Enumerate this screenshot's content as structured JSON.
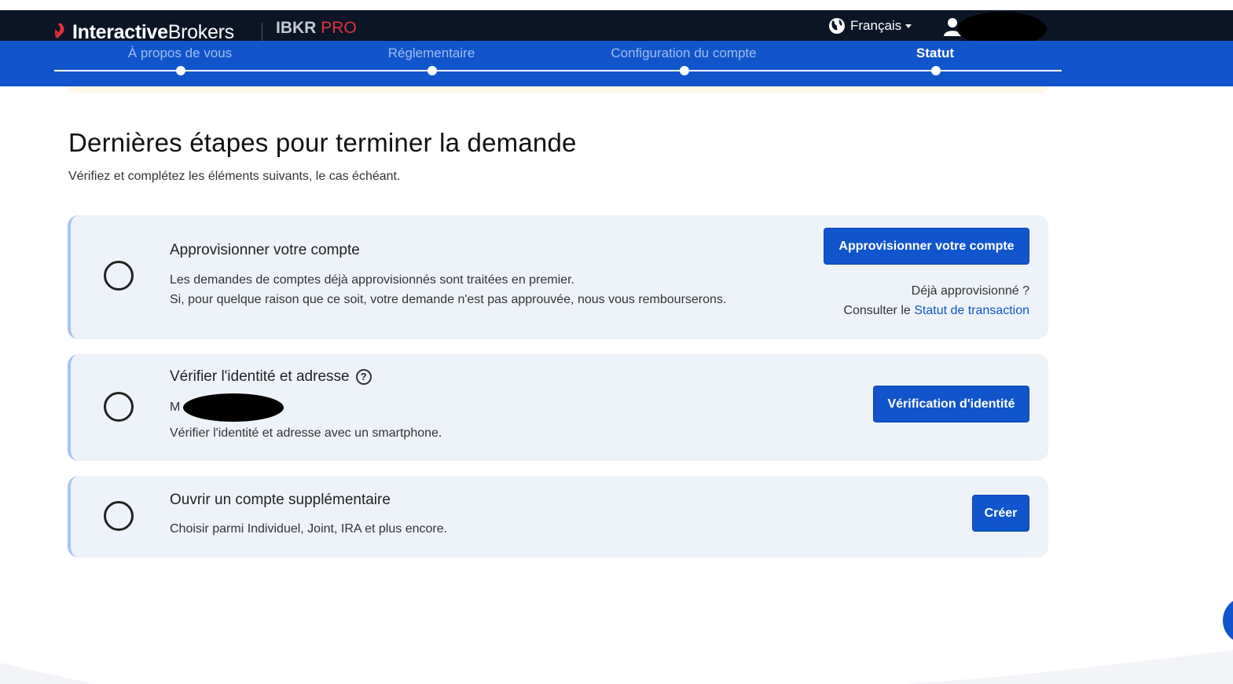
{
  "header": {
    "logo_bold": "Interactive",
    "logo_regular": "Brokers",
    "product_name": "IBKR",
    "product_tier": "PRO",
    "language": "Français",
    "icons": {
      "globe": "globe-icon",
      "user": "user-icon",
      "caret": "caret-down-icon"
    }
  },
  "steps": {
    "items": [
      {
        "label": "À propos de vous",
        "active": false
      },
      {
        "label": "Réglementaire",
        "active": false
      },
      {
        "label": "Configuration du compte",
        "active": false
      },
      {
        "label": "Statut",
        "active": true
      }
    ]
  },
  "main": {
    "title": "Dernières étapes pour terminer la demande",
    "subtitle": "Vérifiez et complétez les éléments suivants, le cas échéant.",
    "cards": [
      {
        "title": "Approvisionner votre compte",
        "lines": [
          "Les demandes de comptes déjà approvisionnés sont traitées en premier.",
          "Si, pour quelque raison que ce soit, votre demande n'est pas approuvée, nous vous rembourserons."
        ],
        "button": "Approvisionner votre compte",
        "note_line1": "Déjà approvisionné ?",
        "note_prefix": "Consulter le ",
        "note_link": "Statut de transaction"
      },
      {
        "title": "Vérifier l'identité et adresse",
        "name_prefix": "M",
        "lines": [
          "Vérifier l'identité et adresse avec un smartphone."
        ],
        "button": "Vérification d'identité",
        "help_icon": "?"
      },
      {
        "title": "Ouvrir un compte supplémentaire",
        "lines": [
          "Choisir parmi Individuel, Joint, IRA et plus encore."
        ],
        "button": "Créer"
      }
    ]
  },
  "colors": {
    "header_bg": "#0b1526",
    "steps_bg": "#1155cc",
    "brand_red": "#e0313a",
    "card_bg": "#eef3fa",
    "button_bg": "#1155cc"
  }
}
